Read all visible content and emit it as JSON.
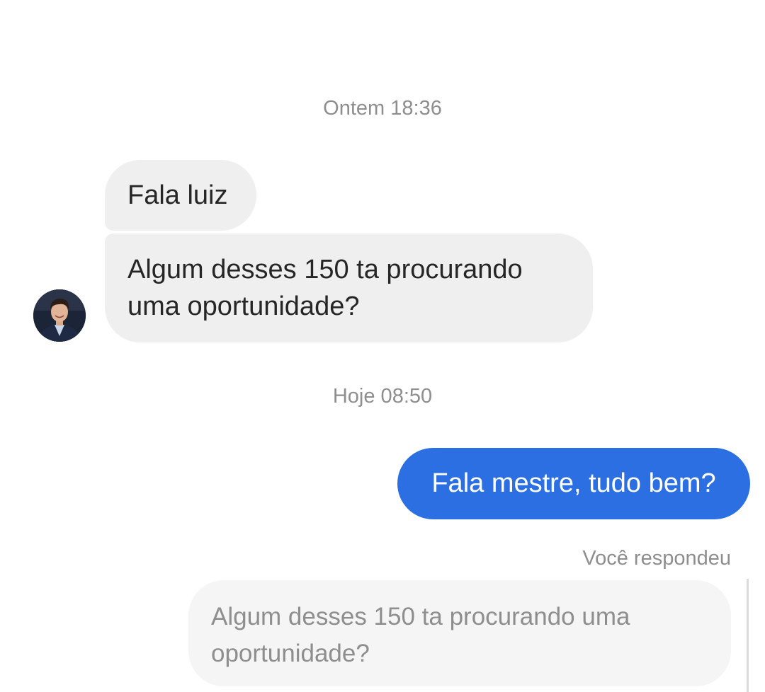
{
  "thread": {
    "timestamp_1": "Ontem 18:36",
    "timestamp_2": "Hoje 08:50"
  },
  "incoming": {
    "messages": [
      "Fala luiz",
      "Algum desses 150 ta procurando uma oportunidade?"
    ]
  },
  "outgoing": {
    "message": "Fala mestre, tudo bem?",
    "replied_label": "Você respondeu",
    "quoted_text": "Algum desses 150 ta procurando uma oportunidade?"
  },
  "colors": {
    "incoming_bubble": "#efefef",
    "outgoing_bubble": "#2b6fe3",
    "timestamp_text": "#8e8e8e"
  },
  "icons": {
    "avatar": "contact-avatar"
  }
}
